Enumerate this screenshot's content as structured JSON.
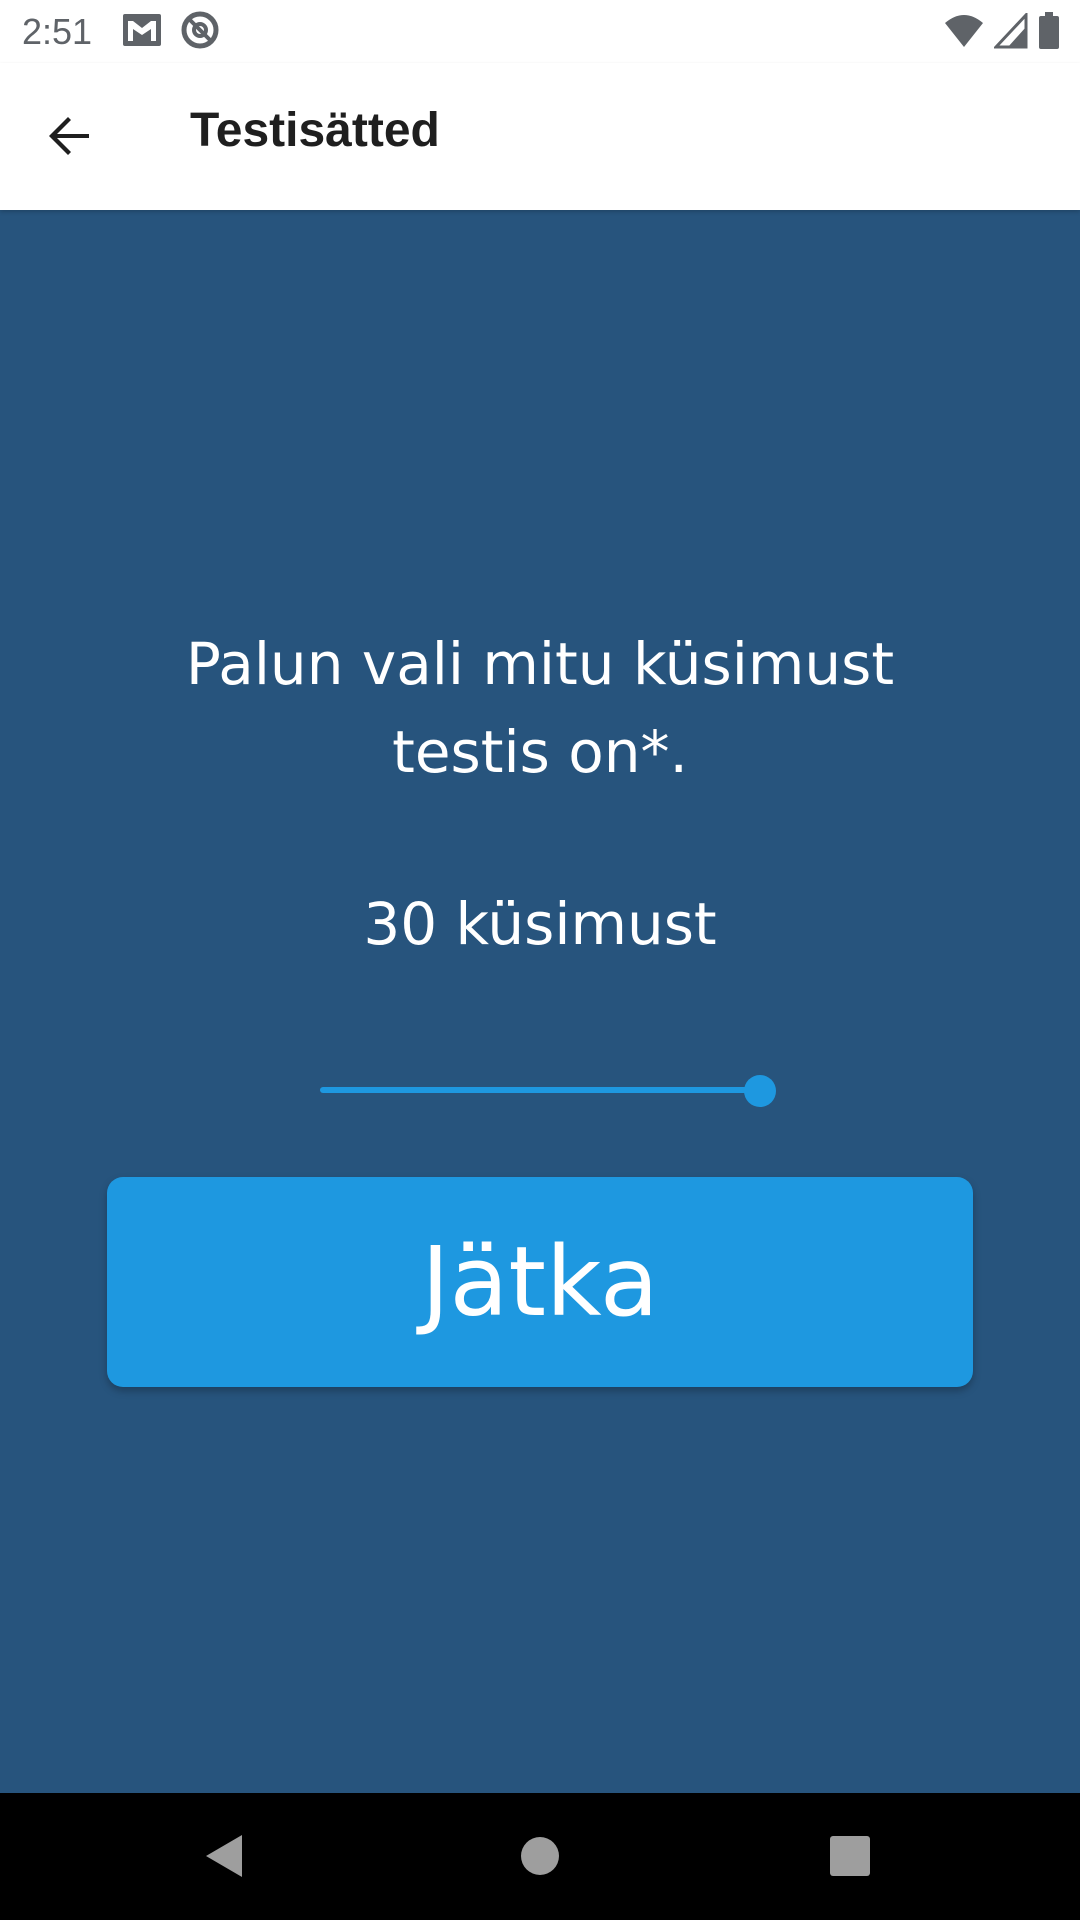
{
  "status_bar": {
    "time": "2:51",
    "icons_left": [
      "gmail-icon",
      "at-sign-icon"
    ],
    "icons_right": [
      "wifi-icon",
      "cell-signal-icon",
      "battery-icon"
    ]
  },
  "app_bar": {
    "back_icon": "arrow-back-icon",
    "title": "Testisätted"
  },
  "main": {
    "prompt": "Palun vali mitu küsimust testis on*.",
    "count_label": "30 küsimust",
    "slider": {
      "value_fraction": 1.0
    },
    "continue_label": "Jätka"
  },
  "nav_bar": {
    "icons": [
      "nav-back-icon",
      "nav-home-icon",
      "nav-recents-icon"
    ]
  },
  "colors": {
    "background": "#27547D",
    "accent": "#1E98E0",
    "app_bar": "#FFFFFF",
    "nav_bar": "#000000"
  }
}
